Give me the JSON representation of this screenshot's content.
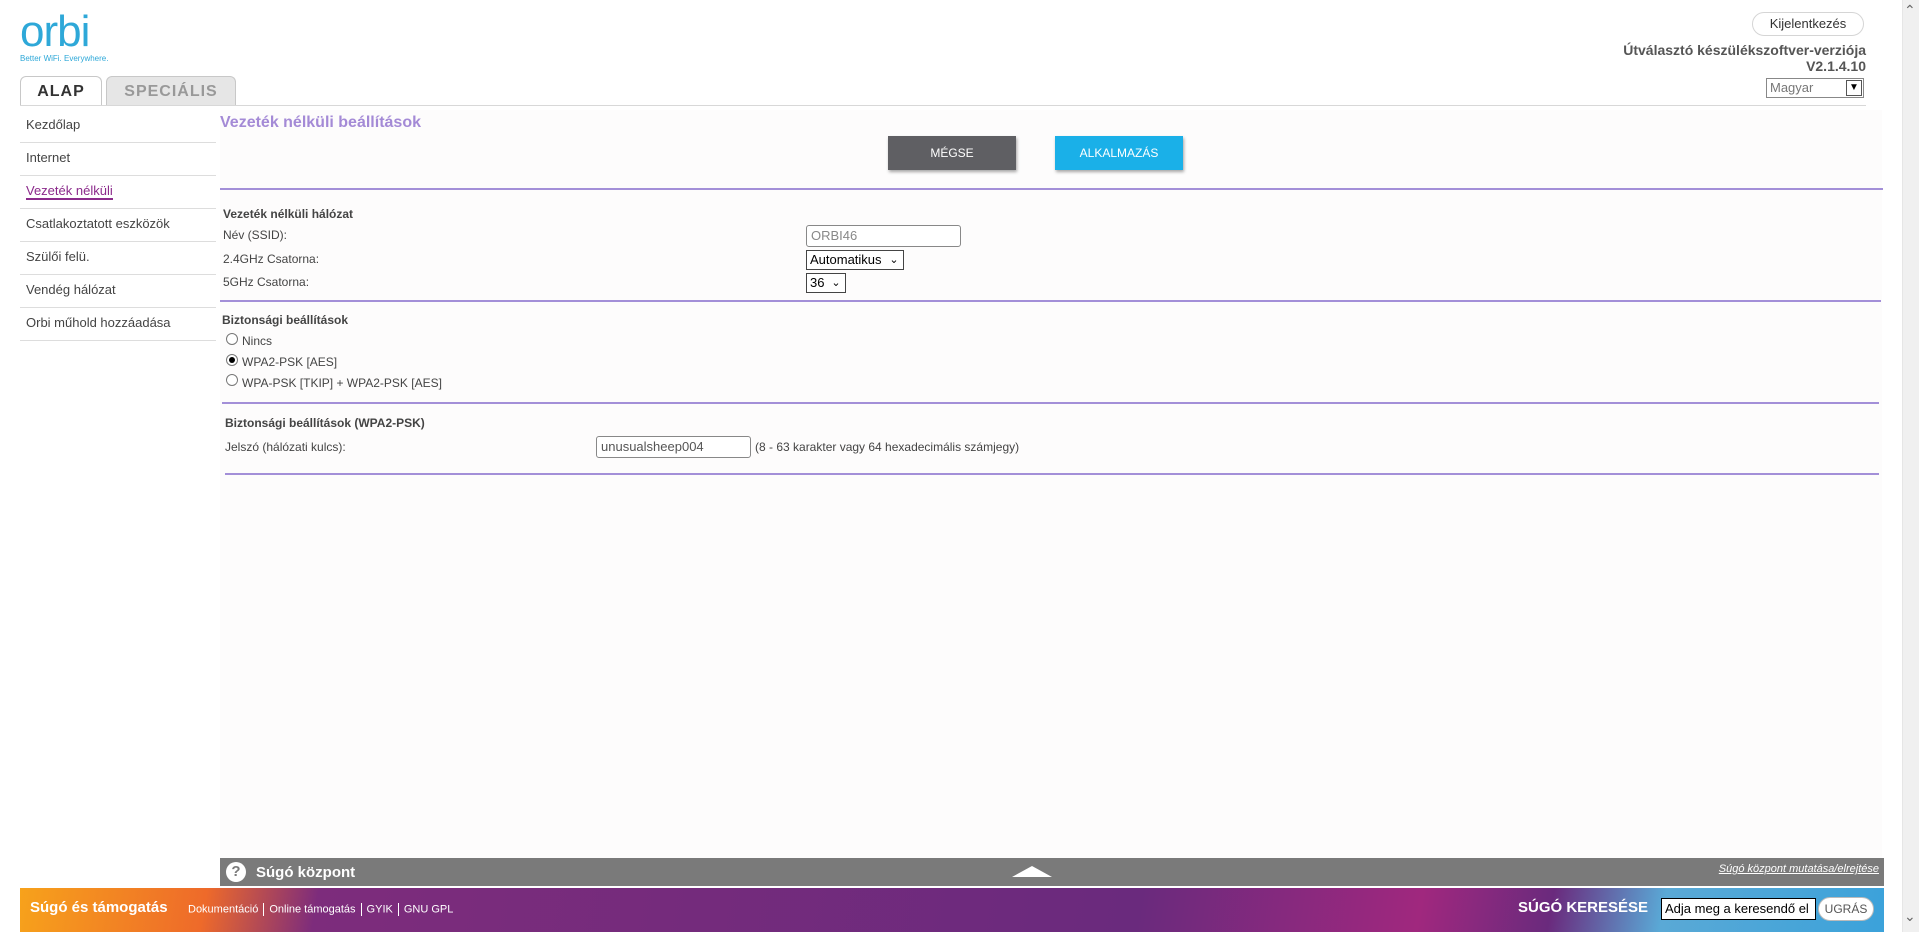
{
  "header": {
    "logo_text": "orbi",
    "logo_tagline": "Better WiFi. Everywhere.",
    "logout_label": "Kijelentkezés",
    "firmware_label": "Útválasztó készülékszoftver-verziója",
    "firmware_version": "V2.1.4.10",
    "language": "Magyar",
    "tabs": [
      {
        "label": "ALAP",
        "active": true
      },
      {
        "label": "SPECIÁLIS",
        "active": false
      }
    ]
  },
  "sidebar": {
    "items": [
      {
        "label": "Kezdőlap"
      },
      {
        "label": "Internet"
      },
      {
        "label": "Vezeték nélküli",
        "active": true
      },
      {
        "label": "Csatlakoztatott eszközök"
      },
      {
        "label": "Szülői felü."
      },
      {
        "label": "Vendég hálózat"
      },
      {
        "label": "Orbi műhold hozzáadása"
      }
    ]
  },
  "main": {
    "title": "Vezeték nélküli beállítások",
    "cancel_label": "MÉGSE",
    "apply_label": "ALKALMAZÁS",
    "wireless_network": {
      "heading": "Vezeték nélküli hálózat",
      "ssid_label": "Név (SSID):",
      "ssid_value": "ORBI46",
      "ch24_label": "2.4GHz Csatorna:",
      "ch24_value": "Automatikus",
      "ch5_label": "5GHz Csatorna:",
      "ch5_value": "36"
    },
    "security": {
      "heading": "Biztonsági beállítások",
      "options": [
        {
          "label": "Nincs",
          "checked": false
        },
        {
          "label": "WPA2-PSK [AES]",
          "checked": true
        },
        {
          "label": "WPA-PSK [TKIP] + WPA2-PSK [AES]",
          "checked": false
        }
      ]
    },
    "security_wpa2": {
      "heading": "Biztonsági beállítások (WPA2-PSK)",
      "password_label": "Jelszó (hálózati kulcs):",
      "password_value": "unusualsheep004",
      "password_hint": "(8 - 63 karakter vagy 64 hexadecimális számjegy)"
    }
  },
  "help": {
    "title": "Súgó központ",
    "toggle_label": "Súgó központ mutatása/elrejtése"
  },
  "footer": {
    "title": "Súgó és támogatás",
    "links": [
      "Dokumentáció",
      "Online támogatás",
      "GYIK",
      "GNU GPL"
    ],
    "search_label": "SÚGÓ KERESÉSE",
    "search_value": "Adja meg a keresendő el",
    "search_button": "UGRÁS"
  },
  "colors": {
    "accent_purple": "#a48ad6",
    "apply_blue": "#1ab0e8",
    "cancel_gray": "#5f5f63",
    "logo_blue": "#2ea8d8"
  }
}
